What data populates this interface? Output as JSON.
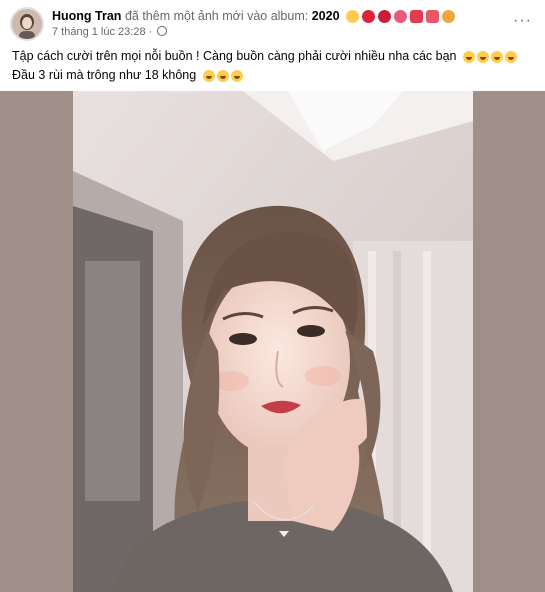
{
  "post": {
    "author": "Huong Tran",
    "action": "đã thêm một ảnh mới vào album:",
    "album": "2020",
    "timestamp": "7 tháng 1 lúc 23:28",
    "more_icon": "more-horizontal-icon",
    "privacy_icon": "globe-icon",
    "title_emojis": [
      "smile",
      "rose",
      "rose",
      "tulip",
      "ribbon",
      "ribbon",
      "bouquet"
    ],
    "caption_line1": "Tập cách cười trên mọi nỗi buồn ! Càng buồn càng phải cười nhiều nha các bạn",
    "caption_line2": "Đầu 3 rùi mà trông như 18 không",
    "photo_alt": "selfie"
  },
  "colors": {
    "text": "#050505",
    "secondary": "#65676b",
    "photo_side": "#a08f88"
  }
}
